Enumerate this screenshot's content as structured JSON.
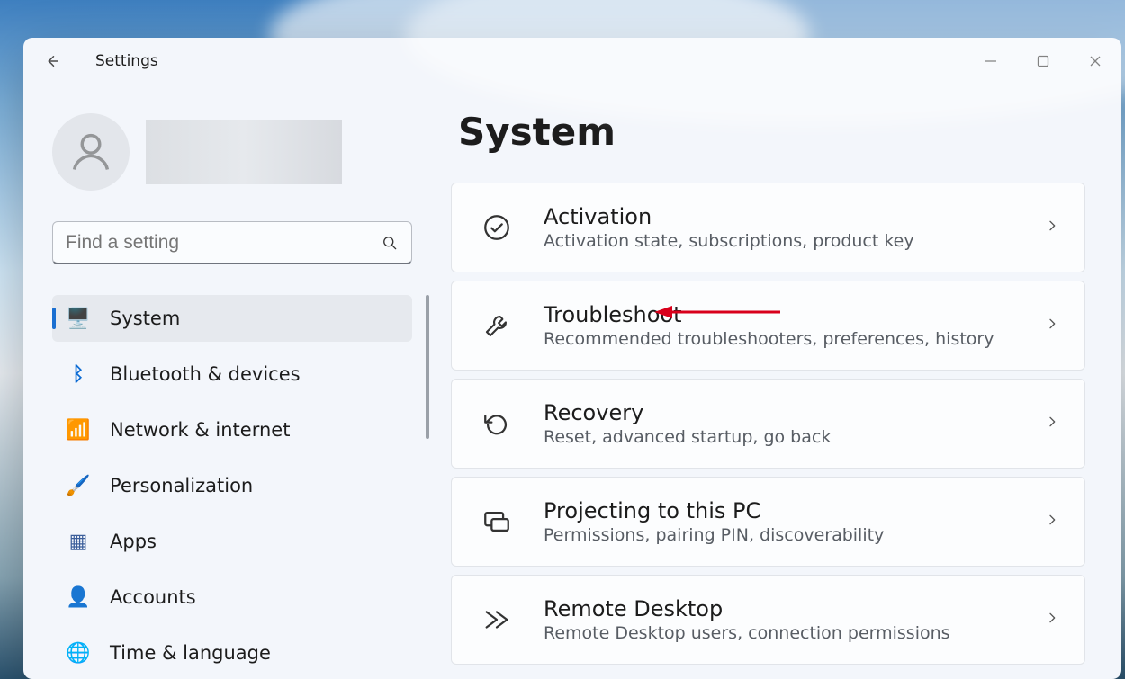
{
  "window": {
    "title": "Settings"
  },
  "search": {
    "placeholder": "Find a setting"
  },
  "sidebar": {
    "items": [
      {
        "label": "System",
        "icon": "🖥️",
        "selected": true
      },
      {
        "label": "Bluetooth & devices",
        "icon": "ᛒ",
        "selected": false
      },
      {
        "label": "Network & internet",
        "icon": "📶",
        "selected": false
      },
      {
        "label": "Personalization",
        "icon": "🖌️",
        "selected": false
      },
      {
        "label": "Apps",
        "icon": "▦",
        "selected": false
      },
      {
        "label": "Accounts",
        "icon": "👤",
        "selected": false
      },
      {
        "label": "Time & language",
        "icon": "🌐",
        "selected": false
      }
    ]
  },
  "page": {
    "title": "System"
  },
  "items": [
    {
      "title": "Activation",
      "sub": "Activation state, subscriptions, product key"
    },
    {
      "title": "Troubleshoot",
      "sub": "Recommended troubleshooters, preferences, history"
    },
    {
      "title": "Recovery",
      "sub": "Reset, advanced startup, go back"
    },
    {
      "title": "Projecting to this PC",
      "sub": "Permissions, pairing PIN, discoverability"
    },
    {
      "title": "Remote Desktop",
      "sub": "Remote Desktop users, connection permissions"
    }
  ],
  "annotation": {
    "target_item_index": 1,
    "color": "#d9001b"
  }
}
